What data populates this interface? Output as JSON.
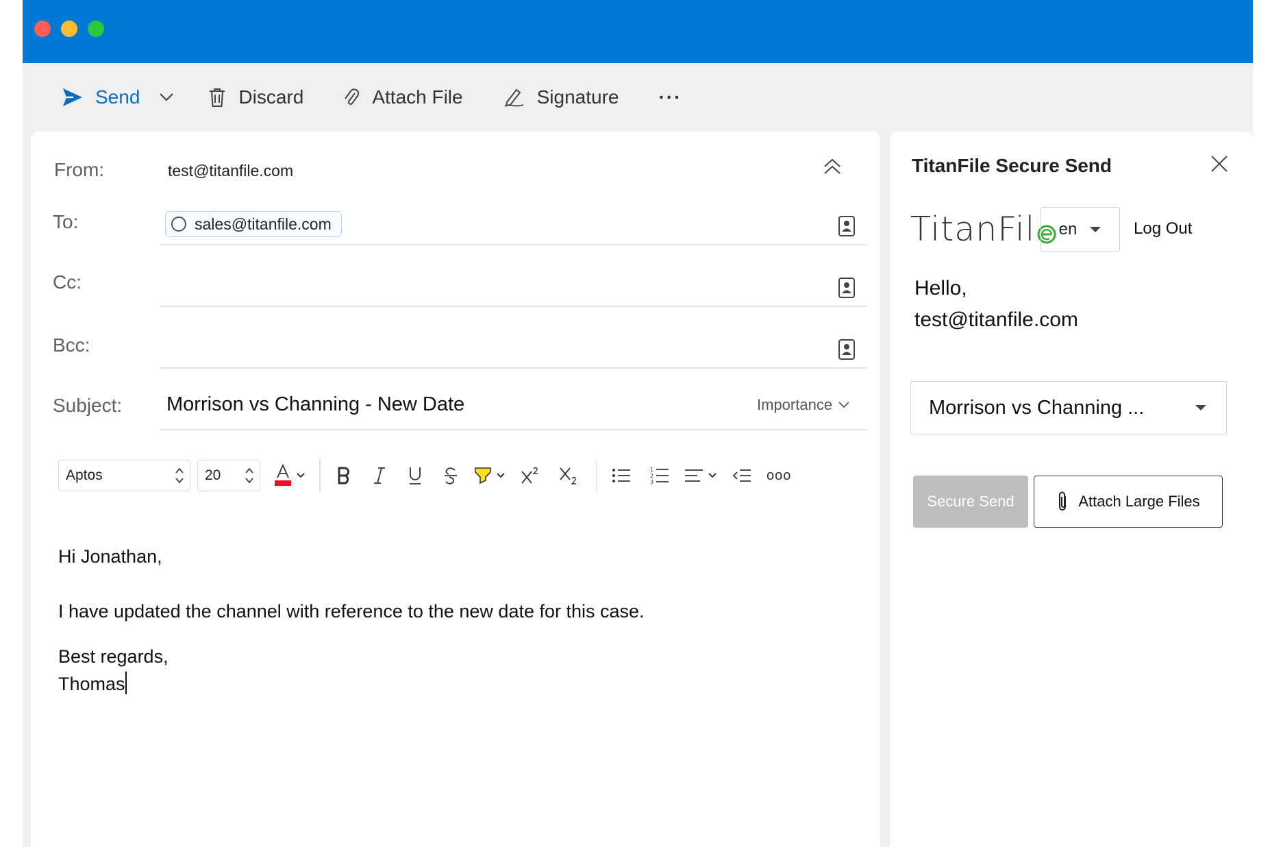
{
  "toolbar": {
    "send_label": "Send",
    "discard_label": "Discard",
    "attach_label": "Attach File",
    "signature_label": "Signature",
    "more_label": "···"
  },
  "header": {
    "from_label": "From:",
    "from_value": "test@titanfile.com",
    "to_label": "To:",
    "to_recipient": "sales@titanfile.com",
    "cc_label": "Cc:",
    "bcc_label": "Bcc:",
    "subject_label": "Subject:",
    "subject_value": "Morrison vs Channing - New Date",
    "importance_label": "Importance"
  },
  "format": {
    "font": "Aptos",
    "size": "20",
    "more": "ooo"
  },
  "body": {
    "line1": "Hi Jonathan,",
    "line2": "I have updated the channel with reference to the new date for this case.",
    "line3": "Best regards,",
    "line4": "Thomas"
  },
  "sidepanel": {
    "title": "TitanFile Secure Send",
    "brand": "TitanFil",
    "lang": "en",
    "logout": "Log Out",
    "hello": "Hello,",
    "email": "test@titanfile.com",
    "channel": "Morrison vs Channing ...",
    "secure_send": "Secure Send",
    "attach_large": "Attach Large Files"
  },
  "colors": {
    "accent": "#0078d4",
    "send_blue": "#0f6cbd",
    "brand_green": "#3aaa35",
    "disabled_gray": "#bdbdbd"
  }
}
